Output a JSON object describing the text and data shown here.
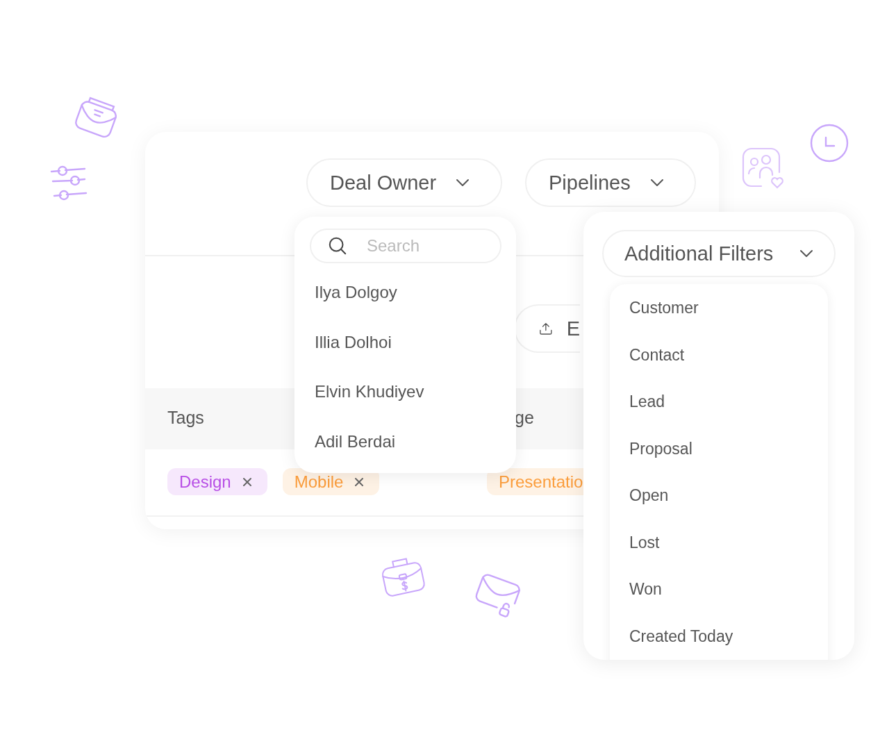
{
  "filters": [
    {
      "label": "Deal Owner"
    },
    {
      "label": "Pipelines"
    }
  ],
  "owner_dropdown": {
    "search": {
      "placeholder": "Search"
    },
    "items": [
      "Ilya Dolgoy",
      "Illia Dolhoi",
      "Elvin Khudiyev",
      "Adil Berdai"
    ]
  },
  "export_button": {
    "label": "E"
  },
  "table": {
    "columns": [
      "Tags",
      "ge"
    ],
    "rows": [
      {
        "tags": [
          {
            "label": "Design",
            "color": "#b84fe6",
            "removable": true
          },
          {
            "label": "Mobile",
            "color": "#fb9d3c",
            "removable": true
          }
        ],
        "column_2": [
          {
            "label": "Presentatio",
            "color": "#fb9d3c"
          }
        ]
      }
    ]
  },
  "additional_filters": {
    "label": "Additional Filters",
    "items": [
      "Customer",
      "Contact",
      "Lead",
      "Proposal",
      "Open",
      "Lost",
      "Won",
      "Created Today"
    ]
  }
}
